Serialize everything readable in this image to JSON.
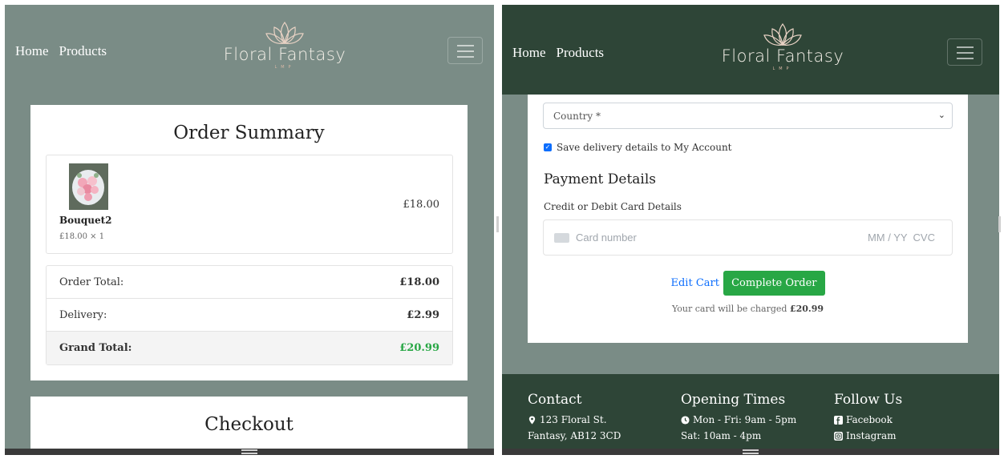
{
  "nav": {
    "home": "Home",
    "products": "Products"
  },
  "logo": {
    "name": "Floral Fantasy",
    "sub": "LMP"
  },
  "summary": {
    "title": "Order Summary",
    "item": {
      "name": "Bouquet2",
      "qty": "£18.00 × 1",
      "price": "£18.00"
    },
    "rows": [
      {
        "label": "Order Total:",
        "value": "£18.00"
      },
      {
        "label": "Delivery:",
        "value": "£2.99"
      },
      {
        "label": "Grand Total:",
        "value": "£20.99"
      }
    ]
  },
  "checkout": {
    "title": "Checkout"
  },
  "form": {
    "country_placeholder": "Country *",
    "save_label": "Save delivery details to My Account",
    "payment_heading": "Payment Details",
    "card_label": "Credit or Debit Card Details",
    "card_number_placeholder": "Card number",
    "card_expiry_cvc": "MM / YY  CVC",
    "edit_cart": "Edit Cart",
    "complete_order": "Complete Order",
    "charge_prefix": "Your card will be charged ",
    "charge_amount": "£20.99"
  },
  "footer": {
    "contact_title": "Contact",
    "address_line1": "123 Floral St.",
    "address_line2": "Fantasy, AB12 3CD",
    "hours_title": "Opening Times",
    "hours_line1": "Mon - Fri: 9am - 5pm",
    "hours_line2": "Sat: 10am - 4pm",
    "follow_title": "Follow Us",
    "facebook": "Facebook",
    "instagram": "Instagram"
  },
  "colors": {
    "sage": "#7a8c86",
    "dark_green": "#2e4537",
    "accent_green": "#28a745",
    "link_blue": "#0d6efd"
  }
}
